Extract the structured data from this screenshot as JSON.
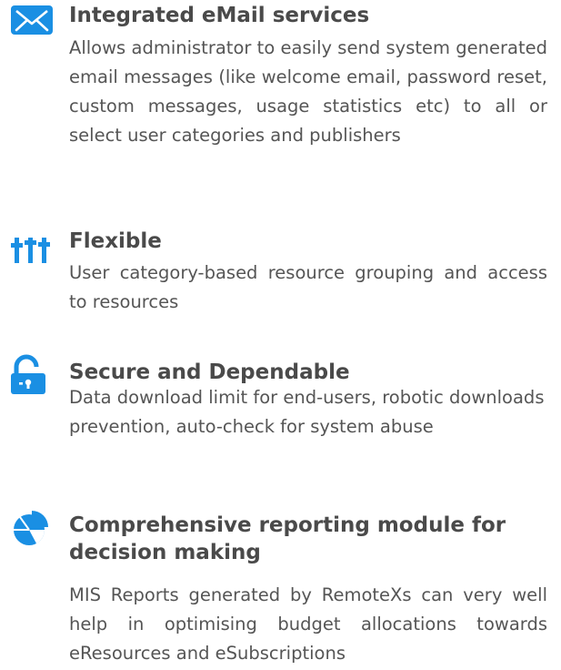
{
  "colors": {
    "icon_blue": "#1a8fe3",
    "title": "#4a4a4a",
    "text": "#555555"
  },
  "features": [
    {
      "icon": "envelope-icon",
      "title": "Integrated eMail services",
      "description": "Allows administrator to easily send system generated email messages (like welcome email, password reset, custom messages, usage statistics etc) to all or select user categories and publishers"
    },
    {
      "icon": "sliders-icon",
      "title": "Flexible",
      "description": "User category-based resource grouping and access to resources"
    },
    {
      "icon": "unlocked-padlock-icon",
      "title": "Secure and Dependable",
      "description": "Data download limit for end-users, robotic downloads prevention, auto-check for system abuse"
    },
    {
      "icon": "pie-chart-icon",
      "title": "Comprehensive reporting module for decision making",
      "description": "MIS Reports generated by RemoteXs can very well help in optimising budget allocations towards eResources and eSubscriptions"
    }
  ]
}
